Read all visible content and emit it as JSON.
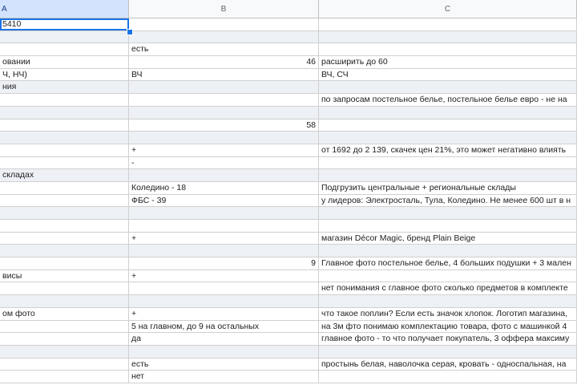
{
  "headers": {
    "a": "A",
    "b": "B",
    "c": "C"
  },
  "rows": [
    {
      "a": "5410",
      "b": "",
      "c": "",
      "shaded": false
    },
    {
      "a": "",
      "b": "",
      "c": "",
      "shaded": true
    },
    {
      "a": "",
      "b": "есть",
      "c": "",
      "shaded": false
    },
    {
      "a": "овании",
      "b": "46",
      "c": "расширить до 60",
      "shaded": false,
      "b_num": true
    },
    {
      "a": "Ч, НЧ)",
      "b": "ВЧ",
      "c": "ВЧ, СЧ",
      "shaded": false
    },
    {
      "a": "ния",
      "b": "",
      "c": "",
      "shaded": true
    },
    {
      "a": "",
      "b": "",
      "c": "по запросам постельное белье, постельное белье евро - не на",
      "shaded": false
    },
    {
      "a": "",
      "b": "",
      "c": "",
      "shaded": true
    },
    {
      "a": "",
      "b": "58",
      "c": "",
      "shaded": false,
      "b_num": true
    },
    {
      "a": "",
      "b": "",
      "c": "",
      "shaded": true
    },
    {
      "a": "",
      "b": "+",
      "c": "от 1692 до 2 139, скачек цен 21%, это может негативно влиять",
      "shaded": false
    },
    {
      "a": "",
      "b": "-",
      "c": "",
      "shaded": false
    },
    {
      "a": "складах",
      "b": "",
      "c": "",
      "shaded": true
    },
    {
      "a": "",
      "b": "Коледино - 18",
      "c": "Подгрузить центральные + региональные склады",
      "shaded": false
    },
    {
      "a": "",
      "b": "ФБС - 39",
      "c": "у лидеров: Электросталь, Тула, Коледино. Не менее 600 шт в н",
      "shaded": false
    },
    {
      "a": "",
      "b": "",
      "c": "",
      "shaded": true
    },
    {
      "a": "",
      "b": "",
      "c": "",
      "shaded": false
    },
    {
      "a": "",
      "b": "+",
      "c": "магазин Décor Magic, бренд Plain Beige",
      "shaded": false
    },
    {
      "a": "",
      "b": "",
      "c": "",
      "shaded": true
    },
    {
      "a": "",
      "b": "9",
      "c": "Главное фото постельное белье, 4 больших подушки + 3 мален",
      "shaded": false,
      "b_num": true
    },
    {
      "a": "висы",
      "b": "+",
      "c": "",
      "shaded": false
    },
    {
      "a": "",
      "b": "",
      "c": "нет понимания с главное фото сколько предметов в комплекте",
      "shaded": false
    },
    {
      "a": "",
      "b": "",
      "c": "",
      "shaded": true
    },
    {
      "a": "ом фото",
      "b": "+",
      "c": "что такое поплин? Если есть значок хлопок. Логотип магазина,",
      "shaded": false
    },
    {
      "a": "",
      "b": "5 на главном, до 9 на остальных",
      "c": "на 3м фто понимаю комплектацию товара, фото с машинкой 4",
      "shaded": false
    },
    {
      "a": "",
      "b": "да",
      "c": "главное фото - то что получает покупатель, 3 оффера максиму",
      "shaded": false
    },
    {
      "a": "",
      "b": "",
      "c": "",
      "shaded": true
    },
    {
      "a": "",
      "b": "есть",
      "c": "простынь белая, наволочка серая, кровать - односпальная, на",
      "shaded": false
    },
    {
      "a": "",
      "b": "нет",
      "c": "",
      "shaded": false
    }
  ]
}
